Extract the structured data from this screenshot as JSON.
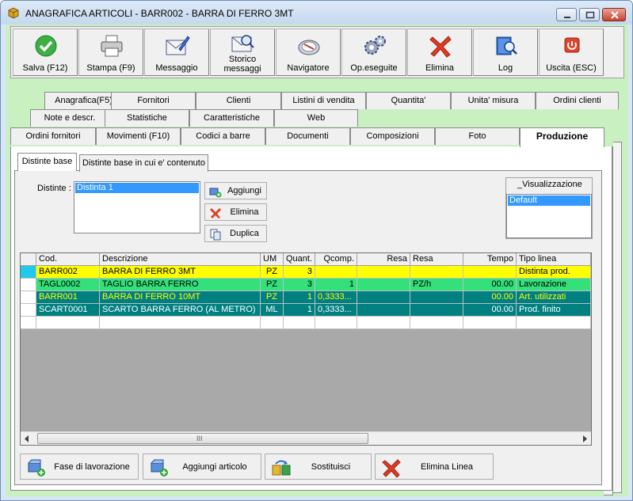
{
  "window": {
    "title": "ANAGRAFICA ARTICOLI - BARR002 - BARRA DI FERRO 3MT",
    "minimize_icon": "minimize-icon",
    "maximize_icon": "maximize-icon",
    "close_icon": "close-icon"
  },
  "toolbar": [
    {
      "label": "Salva (F12)",
      "icon": "checkmark-icon"
    },
    {
      "label": "Stampa (F9)",
      "icon": "printer-icon"
    },
    {
      "label": "Messaggio",
      "icon": "envelope-pen-icon"
    },
    {
      "label": "Storico\nmessaggi",
      "label1": "Storico",
      "label2": "messaggi",
      "icon": "envelope-search-icon"
    },
    {
      "label": "Navigatore",
      "icon": "compass-icon"
    },
    {
      "label": "Op.eseguite",
      "icon": "gears-icon"
    },
    {
      "label": "Elimina",
      "icon": "red-x-icon"
    },
    {
      "label": "Log",
      "icon": "book-search-icon"
    },
    {
      "label": "Uscita (ESC)",
      "icon": "power-icon"
    }
  ],
  "tabs": {
    "row1": [
      "Anagrafica(F5)",
      "Fornitori",
      "Clienti",
      "Listini di vendita",
      "Quantita'",
      "Unita' misura",
      "Ordini clienti"
    ],
    "row2": [
      "Note e descr.",
      "Statistiche",
      "Caratteristiche",
      "Web"
    ],
    "row3": [
      "Ordini fornitori",
      "Movimenti (F10)",
      "Codici a barre",
      "Documenti",
      "Composizioni",
      "Foto",
      "Produzione"
    ],
    "active": "Produzione"
  },
  "subtabs": {
    "items": [
      "Distinte base",
      "Distinte base in cui e' contenuto"
    ],
    "active": "Distinte base"
  },
  "distinte": {
    "label": "Distinte :",
    "items": [
      "Distinta 1"
    ],
    "selected": "Distinta 1",
    "buttons": {
      "add": "Aggiungi",
      "delete": "Elimina",
      "duplicate": "Duplica"
    }
  },
  "visualizzazione": {
    "title": "_Visualizzazione",
    "items": [
      "Default"
    ],
    "selected": "Default"
  },
  "grid": {
    "columns": [
      "Cod.",
      "Descrizione",
      "UM",
      "Quant.",
      "Qcomp.",
      "Resa",
      "Resa",
      "Tempo",
      "Tipo linea"
    ],
    "rows": [
      {
        "cod": "BARR002",
        "descrizione": "BARRA DI FERRO 3MT",
        "um": "PZ",
        "quant": "3",
        "qcomp": "",
        "resa_num": "",
        "resa_unit": "",
        "tempo": "",
        "tipo": "Distinta prod."
      },
      {
        "cod": "TAGL0002",
        "descrizione": "TAGLIO BARRA FERRO",
        "um": "PZ",
        "quant": "3",
        "qcomp": "1",
        "resa_num": "",
        "resa_unit": "PZ/h",
        "tempo": "00.00",
        "tipo": "Lavorazione"
      },
      {
        "cod": "BARR001",
        "descrizione": "BARRA DI FERRO 10MT",
        "um": "PZ",
        "quant": "1",
        "qcomp": "0,3333...",
        "resa_num": "",
        "resa_unit": "",
        "tempo": "00.00",
        "tipo": "Art. utilizzati"
      },
      {
        "cod": "SCART0001",
        "descrizione": "SCARTO BARRA FERRO (AL METRO)",
        "um": "ML",
        "quant": "1",
        "qcomp": "0,3333...",
        "resa_num": "",
        "resa_unit": "",
        "tempo": "00.00",
        "tipo": "Prod. finito"
      }
    ],
    "row_colors": [
      "#ffff00",
      "#33e07a",
      "#008080",
      "#008080"
    ],
    "row_text_colors": [
      "#000000",
      "#000000",
      "#ffff00",
      "#ffffff"
    ],
    "scroll_grip": "III"
  },
  "bottom_buttons": [
    {
      "label": "Fase di lavorazione",
      "icon": "cart-add-icon"
    },
    {
      "label": "Aggiungi articolo",
      "icon": "cart-plus-icon"
    },
    {
      "label": "Sostituisci",
      "icon": "swap-icon"
    },
    {
      "label": "Elimina Linea",
      "icon": "red-x-icon"
    }
  ]
}
